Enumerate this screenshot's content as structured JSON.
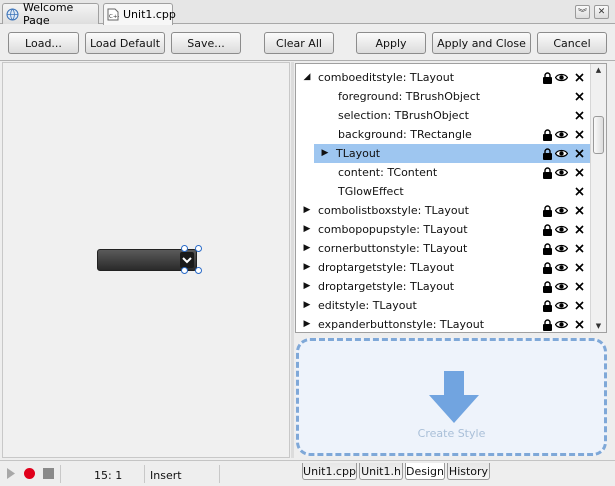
{
  "tabs": [
    {
      "label": "Welcome Page",
      "icon": "globe-icon"
    },
    {
      "label": "Unit1.cpp",
      "icon": "cpp-file-icon"
    }
  ],
  "toolbar": {
    "load": "Load...",
    "load_default": "Load Default",
    "save": "Save...",
    "clear_all": "Clear All",
    "apply": "Apply",
    "apply_close": "Apply and Close",
    "cancel": "Cancel"
  },
  "tree": {
    "rows": [
      {
        "label": "comboeditstyle: TLayout",
        "expander": "expanded",
        "lock": true,
        "eye": true,
        "close": true,
        "level": 0,
        "selected": false
      },
      {
        "label": "foreground: TBrushObject",
        "expander": "",
        "lock": false,
        "eye": false,
        "close": true,
        "level": 1,
        "selected": false
      },
      {
        "label": "selection: TBrushObject",
        "expander": "",
        "lock": false,
        "eye": false,
        "close": true,
        "level": 1,
        "selected": false
      },
      {
        "label": "background: TRectangle",
        "expander": "",
        "lock": true,
        "eye": true,
        "close": true,
        "level": 1,
        "selected": false
      },
      {
        "label": "TLayout",
        "expander": "collapsed",
        "lock": true,
        "eye": true,
        "close": true,
        "level": 1,
        "selected": true
      },
      {
        "label": "content: TContent",
        "expander": "",
        "lock": true,
        "eye": true,
        "close": true,
        "level": 1,
        "selected": false
      },
      {
        "label": "TGlowEffect",
        "expander": "",
        "lock": false,
        "eye": false,
        "close": true,
        "level": 1,
        "selected": false
      },
      {
        "label": "combolistboxstyle: TLayout",
        "expander": "collapsed",
        "lock": true,
        "eye": true,
        "close": true,
        "level": 0,
        "selected": false
      },
      {
        "label": "combopopupstyle: TLayout",
        "expander": "collapsed",
        "lock": true,
        "eye": true,
        "close": true,
        "level": 0,
        "selected": false
      },
      {
        "label": "cornerbuttonstyle: TLayout",
        "expander": "collapsed",
        "lock": true,
        "eye": true,
        "close": true,
        "level": 0,
        "selected": false
      },
      {
        "label": "droptargetstyle: TLayout",
        "expander": "collapsed",
        "lock": true,
        "eye": true,
        "close": true,
        "level": 0,
        "selected": false
      },
      {
        "label": "droptargetstyle: TLayout",
        "expander": "collapsed",
        "lock": true,
        "eye": true,
        "close": true,
        "level": 0,
        "selected": false
      },
      {
        "label": "editstyle: TLayout",
        "expander": "collapsed",
        "lock": true,
        "eye": true,
        "close": true,
        "level": 0,
        "selected": false
      },
      {
        "label": "expanderbuttonstyle: TLayout",
        "expander": "collapsed",
        "lock": true,
        "eye": true,
        "close": true,
        "level": 0,
        "selected": false
      }
    ]
  },
  "create_style": {
    "label": "Create Style",
    "icon": "down-arrow-icon",
    "color": "#5b95db"
  },
  "status": {
    "position": "15:  1",
    "mode": "Insert",
    "bottom_tabs": [
      "Unit1.cpp",
      "Unit1.h",
      "Design",
      "History"
    ],
    "active_tab": "Design"
  },
  "colors": {
    "selection": "#9ec6f0",
    "accent": "#2a6bc8",
    "record": "#e0001b"
  }
}
